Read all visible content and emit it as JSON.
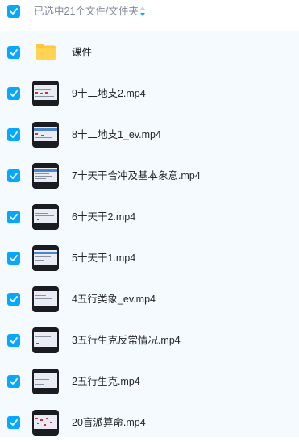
{
  "header": {
    "select_all_checked": true,
    "selection_label": "已选中21个文件/文件夹"
  },
  "items": [
    {
      "name": "课件",
      "type": "folder",
      "checked": true
    },
    {
      "name": "9十二地支2.mp4",
      "type": "video",
      "checked": true
    },
    {
      "name": "8十二地支1_ev.mp4",
      "type": "video",
      "checked": true
    },
    {
      "name": "7十天干合冲及基本象意.mp4",
      "type": "video",
      "checked": true
    },
    {
      "name": "6十天干2.mp4",
      "type": "video",
      "checked": true
    },
    {
      "name": "5十天干1.mp4",
      "type": "video",
      "checked": true
    },
    {
      "name": "4五行类象_ev.mp4",
      "type": "video",
      "checked": true
    },
    {
      "name": "3五行生克反常情况.mp4",
      "type": "video",
      "checked": true
    },
    {
      "name": "2五行生克.mp4",
      "type": "video",
      "checked": true
    },
    {
      "name": "20盲派算命.mp4",
      "type": "video",
      "checked": true
    }
  ],
  "colors": {
    "accent": "#06a7ff",
    "list_bg": "#f5faff",
    "folder": "#ffc93d"
  }
}
